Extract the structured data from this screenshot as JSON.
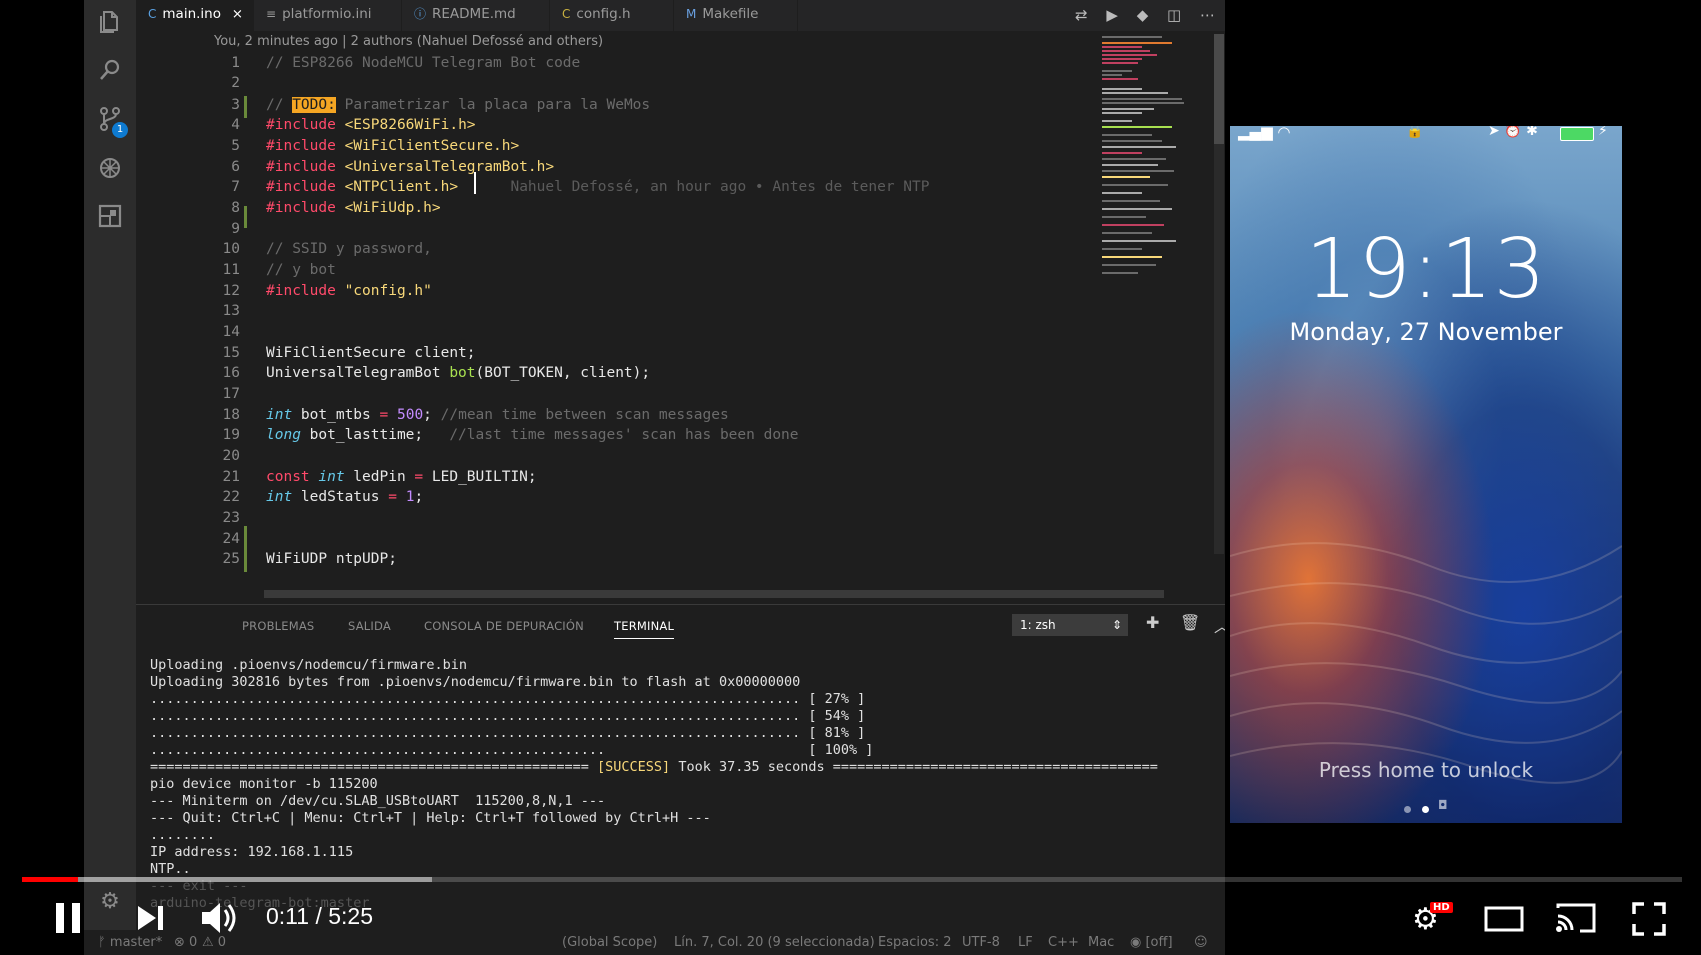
{
  "editor": {
    "tabs": [
      {
        "label": "main.ino",
        "icon": "C"
      },
      {
        "label": "platformio.ini",
        "icon": "≡"
      },
      {
        "label": "README.md",
        "icon": "ⓘ"
      },
      {
        "label": "config.h",
        "icon": "C"
      },
      {
        "label": "Makefile",
        "icon": "M"
      }
    ],
    "close_glyph": "×",
    "blame_header": "You, 2 minutes ago | 2 authors (Nahuel Defossé and others)",
    "lines": {
      "l1": "// ESP8266 NodeMCU Telegram Bot code",
      "l3_a": "// ",
      "l3_todo": "TODO:",
      "l3_b": " Parametrizar la placa para la WeMos",
      "inc": "#include",
      "l4": "<ESP8266WiFi.h>",
      "l5": "<WiFiClientSecure.h>",
      "l6": "<UniversalTelegramBot.h>",
      "l7": "<NTPClient.h>",
      "l7_blame": "Nahuel Defossé, an hour ago • Antes de tener NTP",
      "l8": "<WiFiUdp.h>",
      "l10": "// SSID y password,",
      "l11": "// y bot",
      "l12": "\"config.h\"",
      "l15": "WiFiClientSecure client;",
      "l16_a": "UniversalTelegramBot ",
      "l16_fn": "bot",
      "l16_b": "(BOT_TOKEN, client);",
      "l18_ty": "int",
      "l18_a": " bot_mtbs ",
      "l18_op": "=",
      "l18_num": " 500",
      "l18_b": ";",
      "l18_cm": " //mean time between scan messages",
      "l19_ty": "long",
      "l19_a": " bot_lasttime;",
      "l19_cm": "   //last time messages' scan has been done",
      "l21_kw": "const",
      "l21_ty": " int",
      "l21_a": " ledPin ",
      "l21_op": "=",
      "l21_b": " LED_BUILTIN;",
      "l22_ty": "int",
      "l22_a": " ledStatus ",
      "l22_op": "=",
      "l22_num": " 1",
      "l22_b": ";",
      "l25": "WiFiUDP ntpUDP;"
    },
    "line_numbers": [
      "1",
      "2",
      "3",
      "4",
      "5",
      "6",
      "7",
      "8",
      "9",
      "10",
      "11",
      "12",
      "13",
      "14",
      "15",
      "16",
      "17",
      "18",
      "19",
      "20",
      "21",
      "22",
      "23",
      "24",
      "25"
    ]
  },
  "panel": {
    "tabs": [
      "PROBLEMAS",
      "SALIDA",
      "CONSOLA DE DEPURACIÓN",
      "TERMINAL"
    ],
    "shell": "1: zsh",
    "terminal": {
      "t1": "Uploading .pioenvs/nodemcu/firmware.bin",
      "t2": "Uploading 302816 bytes from .pioenvs/nodemcu/firmware.bin to flash at 0x00000000",
      "t3": "................................................................................ [ 27% ]",
      "t4": "................................................................................ [ 54% ]",
      "t5": "................................................................................ [ 81% ]",
      "t6": "........................................................                         [ 100% ]",
      "t7_a": "====================================================== ",
      "t7_s": "[SUCCESS]",
      "t7_b": " Took 37.35 seconds ========================================",
      "t8": "pio device monitor -b 115200",
      "t9": "--- Miniterm on /dev/cu.SLAB_USBtoUART  115200,8,N,1 ---",
      "t10": "--- Quit: Ctrl+C | Menu: Ctrl+T | Help: Ctrl+T followed by Ctrl+H ---",
      "t11": "........",
      "t12": "IP address: 192.168.1.115",
      "t13": "NTP..",
      "t14": "--- exit ---",
      "t15": "arduino-telegram-bot:master"
    }
  },
  "statusbar": {
    "branch": "ᚠ master*",
    "errors": "⊗ 0",
    "warnings": "⚠ 0",
    "scope": "(Global Scope)",
    "position": "Lín. 7, Col. 20 (9 seleccionada)",
    "spaces": "Espacios: 2",
    "encoding": "UTF-8",
    "eol": "LF",
    "language": "C++",
    "platform": "Mac",
    "off": "◉ [off]"
  },
  "phone": {
    "time": "19:13",
    "date": "Monday, 27 November",
    "unlock": "Press home to unlock"
  },
  "player": {
    "time": "0:11 / 5:25",
    "hd": "HD",
    "progress_played": 0.034,
    "progress_buffered": 0.247
  }
}
